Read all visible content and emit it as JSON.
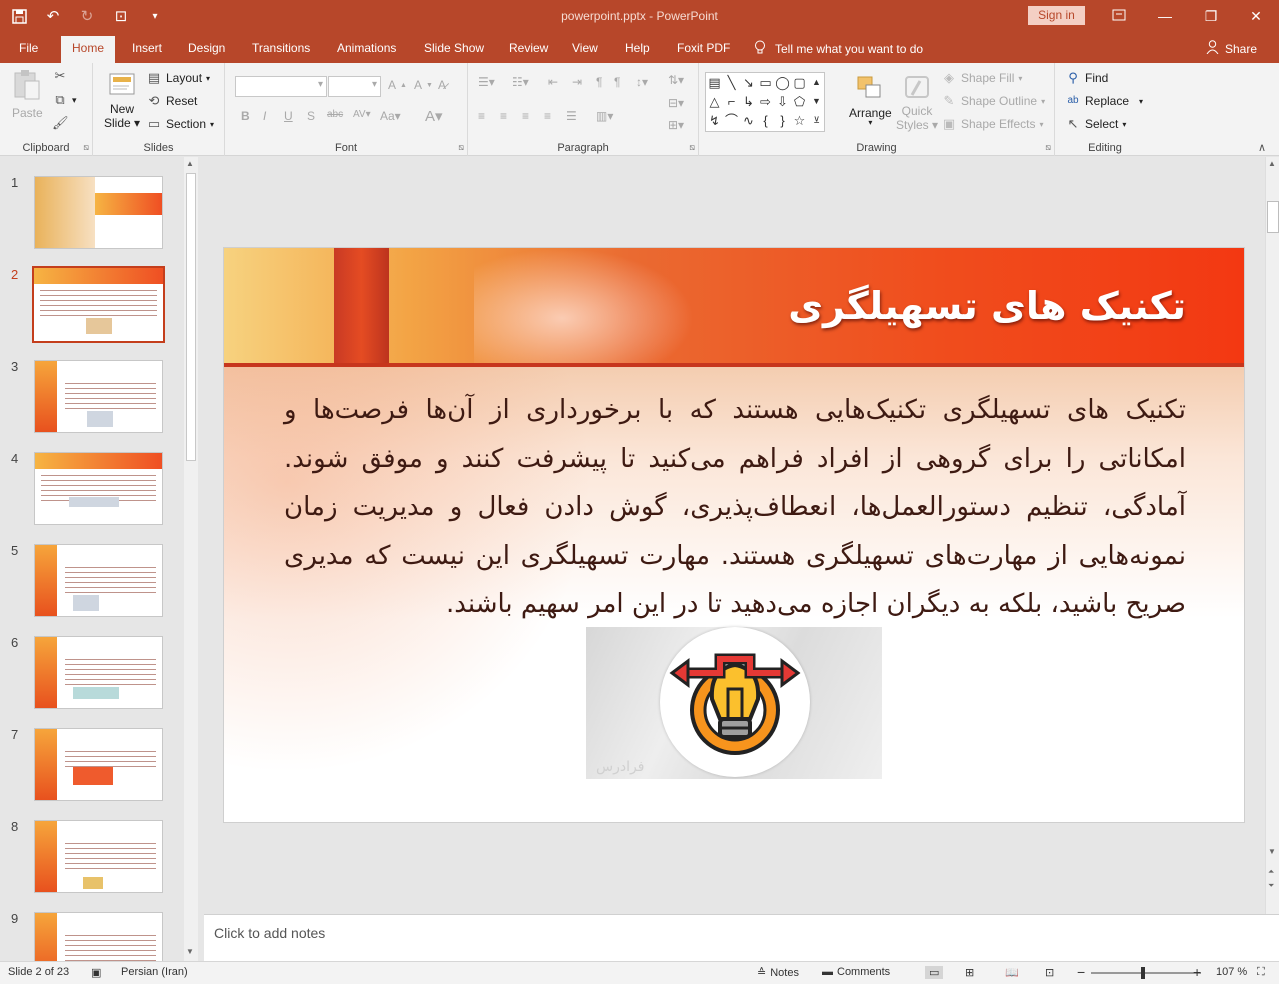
{
  "titlebar": {
    "title": "powerpoint.pptx  -  PowerPoint",
    "signin": "Sign in",
    "minimize": "—",
    "restore": "❐",
    "close": "✕"
  },
  "tabs": [
    {
      "label": "File"
    },
    {
      "label": "Home"
    },
    {
      "label": "Insert"
    },
    {
      "label": "Design"
    },
    {
      "label": "Transitions"
    },
    {
      "label": "Animations"
    },
    {
      "label": "Slide Show"
    },
    {
      "label": "Review"
    },
    {
      "label": "View"
    },
    {
      "label": "Help"
    },
    {
      "label": "Foxit PDF"
    }
  ],
  "tellme": "Tell me what you want to do",
  "share": "Share",
  "ribbon": {
    "clipboard": {
      "label": "Clipboard",
      "paste": "Paste"
    },
    "slides": {
      "label": "Slides",
      "new_slide_1": "New",
      "new_slide_2": "Slide",
      "layout": "Layout",
      "reset": "Reset",
      "section": "Section"
    },
    "font": {
      "label": "Font"
    },
    "paragraph": {
      "label": "Paragraph"
    },
    "drawing": {
      "label": "Drawing",
      "arrange": "Arrange",
      "quick_styles_1": "Quick",
      "quick_styles_2": "Styles",
      "shape_fill": "Shape Fill",
      "shape_outline": "Shape Outline",
      "shape_effects": "Shape Effects"
    },
    "editing": {
      "label": "Editing",
      "find": "Find",
      "replace": "Replace",
      "select": "Select"
    }
  },
  "slides_panel": {
    "thumbnails": [
      {
        "num": "1"
      },
      {
        "num": "2"
      },
      {
        "num": "3"
      },
      {
        "num": "4"
      },
      {
        "num": "5"
      },
      {
        "num": "6"
      },
      {
        "num": "7"
      },
      {
        "num": "8"
      },
      {
        "num": "9"
      }
    ],
    "selected": 2
  },
  "slide": {
    "title": "تکنیک های تسهیلگری",
    "body": "تکنیک های تسهیلگری تکنیک‌هایی هستند که با برخورداری از آن‌ها فرصت‌ها و امکاناتی را برای گروهی از افراد فراهم می‌کنید تا پیشرفت کنند و موفق شوند. آمادگی، تنظیم دستورالعمل‌ها، انعطاف‌پذیری، گوش دادن فعال و مدیریت زمان نمونه‌هایی از مهارت‌های تسهیلگری هستند. مهارت تسهیلگری این نیست که مدیری صریح باشید، بلکه به دیگران اجازه می‌دهید تا در این امر سهیم باشند.",
    "watermark": "فرادرس"
  },
  "notes": {
    "placeholder": "Click to add notes"
  },
  "status": {
    "slide_info": "Slide 2 of 23",
    "language": "Persian (Iran)",
    "notes": "Notes",
    "comments": "Comments",
    "zoom": "107 %"
  }
}
